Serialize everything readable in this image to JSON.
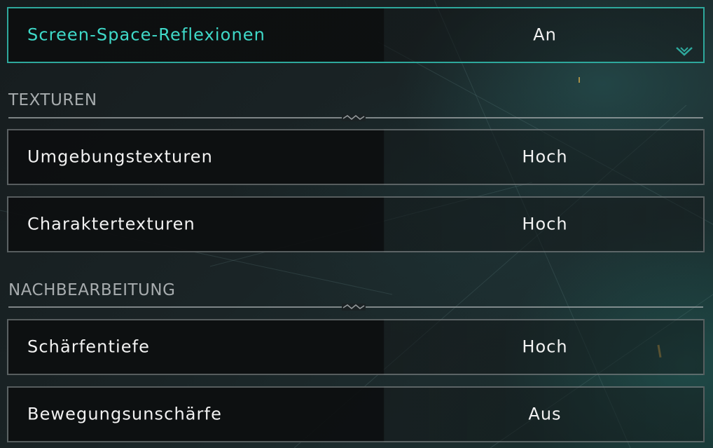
{
  "top_setting": {
    "label": "Screen-Space-Reflexionen",
    "value": "An"
  },
  "sections": [
    {
      "title": "TEXTUREN",
      "settings": [
        {
          "label": "Umgebungstexturen",
          "value": "Hoch"
        },
        {
          "label": "Charaktertexturen",
          "value": "Hoch"
        }
      ]
    },
    {
      "title": "NACHBEARBEITUNG",
      "settings": [
        {
          "label": "Schärfentiefe",
          "value": "Hoch"
        },
        {
          "label": "Bewegungsunschärfe",
          "value": "Aus"
        }
      ]
    }
  ],
  "icons": {
    "dropdown": "chevron-down-icon",
    "divider_ornament": "zigzag-ornament-icon"
  },
  "colors": {
    "accent": "#3fd9c8",
    "accent_border": "#2ea89c",
    "text": "#f2f2f2",
    "section_title": "#a7acae"
  }
}
